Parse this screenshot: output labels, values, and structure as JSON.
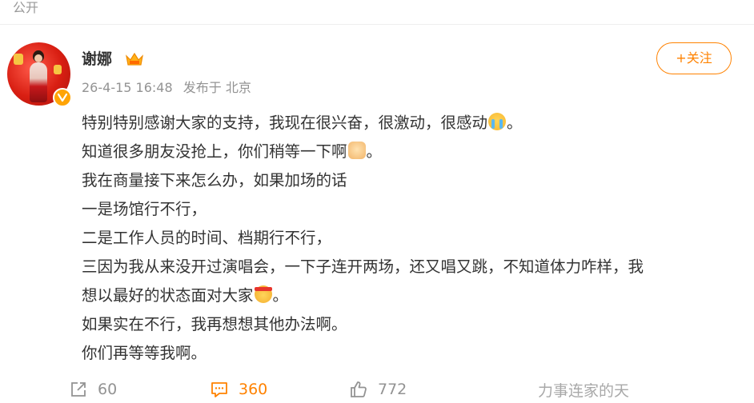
{
  "header": {
    "visibility": "公开"
  },
  "author": {
    "name": "谢娜",
    "avatar_icon": "avatar-photo",
    "verified_icon": "verified-badge-icon",
    "vip_icon": "vip-crown-icon"
  },
  "meta": {
    "time": "26-4-15 16:48",
    "source": "发布于 北京"
  },
  "follow": {
    "label": "+关注"
  },
  "post": {
    "lines": [
      "特别特别感谢大家的支持，我现在很兴奋，很激动，很感动",
      "。",
      "知道很多朋友没抢上，你们稍等一下啊",
      "。",
      "我在商量接下来怎么办，如果加场的话",
      "一是场馆行不行，",
      "二是工作人员的时间、档期行不行，",
      "三因为我从来没开过演唱会，一下子连开两场，还又唱又跳，不知道体力咋样，我",
      "想以最好的状态面对大家",
      "。",
      "如果实在不行，我再想想其他办法啊。",
      "你们再等等我啊。"
    ],
    "emojis": [
      "crying-emoji",
      "fist-emoji",
      "headband-emoji"
    ]
  },
  "actions": {
    "repost_count": "60",
    "comment_count": "360",
    "like_count": "772",
    "more_text": "力事连家的天",
    "accent": "#ff8200"
  }
}
